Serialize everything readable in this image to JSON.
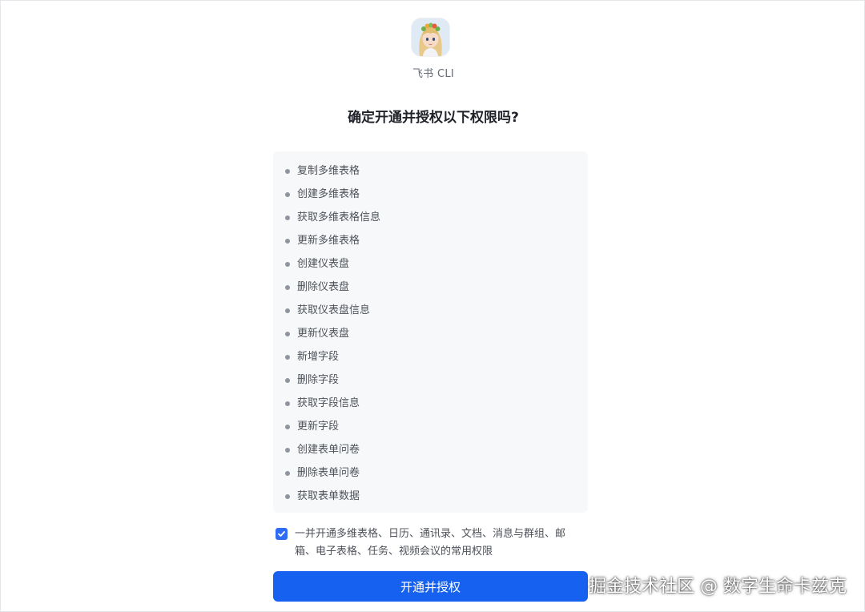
{
  "app": {
    "icon": "feishu-cli-avatar-icon",
    "name": "飞书 CLI"
  },
  "dialog": {
    "title": "确定开通并授权以下权限吗?",
    "permissions": [
      "复制多维表格",
      "创建多维表格",
      "获取多维表格信息",
      "更新多维表格",
      "创建仪表盘",
      "删除仪表盘",
      "获取仪表盘信息",
      "更新仪表盘",
      "新增字段",
      "删除字段",
      "获取字段信息",
      "更新字段",
      "创建表单问卷",
      "删除表单问卷",
      "获取表单数据"
    ],
    "consent": {
      "checked": true,
      "text": "一并开通多维表格、日历、通讯录、文档、消息与群组、邮箱、电子表格、任务、视频会议的常用权限"
    },
    "primary_button": "开通并授权"
  },
  "watermark": "掘金技术社区 @ 数字生命卡兹克",
  "colors": {
    "accent": "#1661f0",
    "checkbox": "#2f6cf5",
    "list_bg": "#f7f8fa",
    "text": "#1f2329",
    "muted_text": "#4e5259"
  }
}
